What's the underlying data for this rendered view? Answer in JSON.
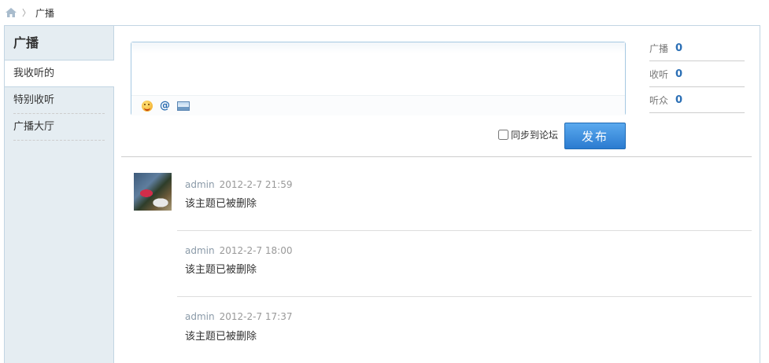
{
  "breadcrumb": {
    "home_icon": "home-icon",
    "separator": "〉",
    "current": "广播"
  },
  "sidebar": {
    "title": "广播",
    "items": [
      {
        "label": "我收听的",
        "active": true
      },
      {
        "label": "特别收听",
        "active": false
      },
      {
        "label": "广播大厅",
        "active": false
      }
    ]
  },
  "composer": {
    "placeholder": "",
    "value": "",
    "tools": [
      "smile-icon",
      "at-icon",
      "image-icon"
    ],
    "at_glyph": "@",
    "sync_label": "同步到论坛",
    "sync_checked": false,
    "publish_label": "发布"
  },
  "stats": [
    {
      "label": "广播",
      "value": "0"
    },
    {
      "label": "收听",
      "value": "0"
    },
    {
      "label": "听众",
      "value": "0"
    }
  ],
  "feed": [
    {
      "user": "admin",
      "time": "2012-2-7 21:59",
      "text": "该主题已被删除"
    },
    {
      "user": "admin",
      "time": "2012-2-7 18:00",
      "text": "该主题已被删除"
    },
    {
      "user": "admin",
      "time": "2012-2-7 17:37",
      "text": "该主题已被删除"
    }
  ],
  "colors": {
    "sidebar_bg": "#e5edf2",
    "border": "#c2d5e3",
    "accent": "#2b7bd0",
    "count": "#2b6fb5"
  }
}
